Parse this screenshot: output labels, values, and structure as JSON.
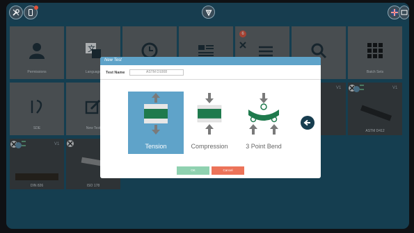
{
  "dialog": {
    "title": "New Test",
    "test_name_label": "Test Name",
    "test_name_value": "ASTM D1008",
    "options": [
      {
        "label": "Tension",
        "selected": true
      },
      {
        "label": "Compression",
        "selected": false
      },
      {
        "label": "3 Point Bend",
        "selected": false
      }
    ],
    "ok_label": "OK",
    "cancel_label": "Cancel"
  },
  "tiles": {
    "row1": [
      "Permissions",
      "Language",
      "",
      "",
      "",
      "",
      "Batch Sets"
    ],
    "row2": [
      "SDE",
      "New Test"
    ],
    "photo_tiles": [
      "DIN 826",
      "ISO 178",
      "ASTM D412"
    ],
    "version_tag": "V1",
    "notification_count": "6"
  },
  "colors": {
    "screen_bg": "#184d63",
    "topbar_bg": "#173d4f",
    "dialog_header": "#5fa3c9",
    "selected_option": "#5fa3c9",
    "ok": "#8fd1b0",
    "cancel": "#ec7359",
    "specimen_green": "#1f7a4d"
  }
}
